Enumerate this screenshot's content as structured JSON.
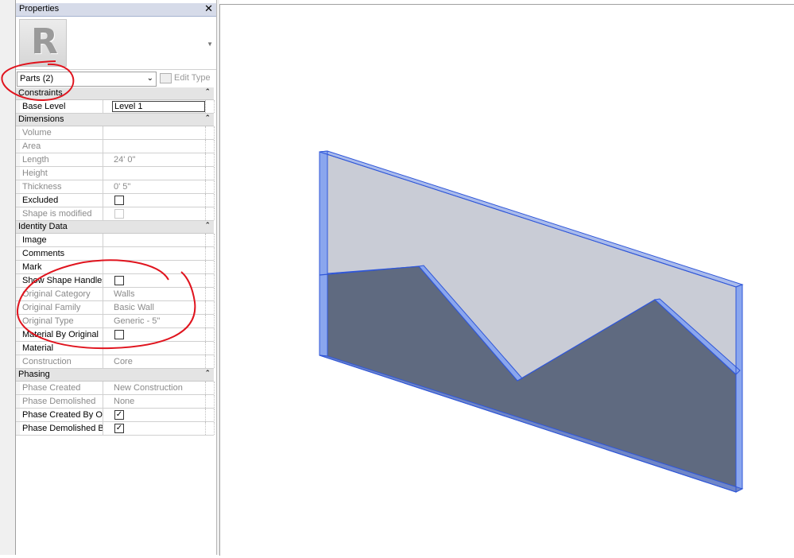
{
  "properties": {
    "title": "Properties",
    "close_icon": "close-icon",
    "type_logo_letter": "R",
    "selector": {
      "value": "Parts (2)"
    },
    "edit_type_label": "Edit Type",
    "groups": [
      {
        "label": "Constraints",
        "rows": [
          {
            "name": "Base Level",
            "value": "Level 1",
            "enabled": true,
            "active": true
          }
        ]
      },
      {
        "label": "Dimensions",
        "rows": [
          {
            "name": "Volume",
            "value": "",
            "enabled": false
          },
          {
            "name": "Area",
            "value": "",
            "enabled": false
          },
          {
            "name": "Length",
            "value": "24'  0\"",
            "enabled": false
          },
          {
            "name": "Height",
            "value": "",
            "enabled": false
          },
          {
            "name": "Thickness",
            "value": "0'  5\"",
            "enabled": false
          },
          {
            "name": "Excluded",
            "checkbox": false,
            "enabled": true
          },
          {
            "name": "Shape is modified",
            "checkbox": false,
            "enabled": false
          }
        ]
      },
      {
        "label": "Identity Data",
        "rows": [
          {
            "name": "Image",
            "value": "",
            "enabled": true
          },
          {
            "name": "Comments",
            "value": "",
            "enabled": true
          },
          {
            "name": "Mark",
            "value": "",
            "enabled": true
          },
          {
            "name": "Show Shape Handles",
            "checkbox": false,
            "enabled": true
          },
          {
            "name": "Original Category",
            "value": "Walls",
            "enabled": false
          },
          {
            "name": "Original Family",
            "value": "Basic Wall",
            "enabled": false
          },
          {
            "name": "Original Type",
            "value": "Generic - 5\"",
            "enabled": false
          },
          {
            "name": "Material By Original",
            "checkbox": false,
            "enabled": true
          },
          {
            "name": "Material",
            "value": "",
            "enabled": true
          },
          {
            "name": "Construction",
            "value": "Core",
            "enabled": false
          }
        ]
      },
      {
        "label": "Phasing",
        "rows": [
          {
            "name": "Phase Created",
            "value": "New Construction",
            "enabled": false
          },
          {
            "name": "Phase Demolished",
            "value": "None",
            "enabled": false
          },
          {
            "name": "Phase Created By Ori...",
            "checkbox": true,
            "enabled": true
          },
          {
            "name": "Phase Demolished By...",
            "checkbox": true,
            "enabled": true
          }
        ]
      }
    ]
  },
  "colors": {
    "wall_light": "#c9ccd6",
    "wall_dark": "#5f6a80",
    "edge_blue": "#2f56d8",
    "edge_fill": "#8aa6ee",
    "annotation": "#e0141e"
  }
}
